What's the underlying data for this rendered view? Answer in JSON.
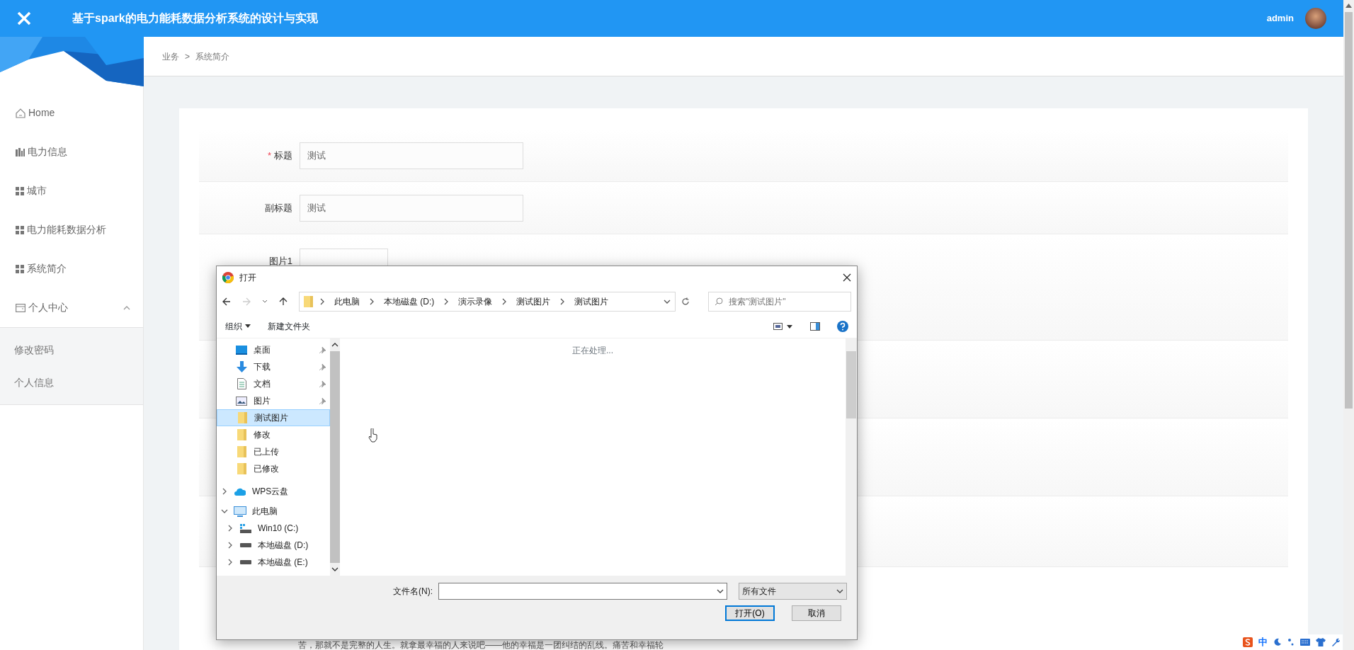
{
  "header": {
    "title": "基于spark的电力能耗数据分析系统的设计与实现",
    "user": "admin"
  },
  "sidebar": {
    "items": [
      {
        "label": "Home",
        "kind": "home"
      },
      {
        "label": "电力信息",
        "kind": "chart"
      },
      {
        "label": "城市",
        "kind": "grid"
      },
      {
        "label": "电力能耗数据分析",
        "kind": "grid"
      },
      {
        "label": "系统简介",
        "kind": "grid"
      },
      {
        "label": "个人中心",
        "kind": "card",
        "expanded": true,
        "children": [
          {
            "label": "修改密码"
          },
          {
            "label": "个人信息"
          }
        ]
      }
    ]
  },
  "breadcrumb": {
    "items": [
      "业务",
      "系统简介"
    ],
    "separator": ">"
  },
  "form": {
    "required_symbol": "*",
    "fields": [
      {
        "label": "标题",
        "required": true,
        "kind": "text",
        "value": "测试"
      },
      {
        "label": "副标题",
        "required": false,
        "kind": "text",
        "value": "测试"
      },
      {
        "label": "图片1",
        "required": false,
        "kind": "upload"
      }
    ],
    "content_excerpt": "苦，那就不是完整的人生。就拿最幸福的人来说吧——他的幸福是一团纠结的乱线。痛苦和幸福轮"
  },
  "dialog": {
    "title": "打开",
    "path": [
      "此电脑",
      "本地磁盘 (D:)",
      "演示录像",
      "测试图片",
      "测试图片"
    ],
    "search_placeholder": "搜索\"测试图片\"",
    "toolbar": [
      "组织",
      "新建文件夹"
    ],
    "nav": [
      {
        "kind": "desktop",
        "label": "桌面",
        "pinned": true,
        "selected": false
      },
      {
        "kind": "download",
        "label": "下载",
        "pinned": true,
        "selected": false
      },
      {
        "kind": "document",
        "label": "文档",
        "pinned": true,
        "selected": false
      },
      {
        "kind": "picture",
        "label": "图片",
        "pinned": true,
        "selected": false
      },
      {
        "kind": "folder",
        "label": "测试图片",
        "pinned": false,
        "selected": true
      },
      {
        "kind": "folder",
        "label": "修改",
        "pinned": false,
        "selected": false
      },
      {
        "kind": "folder",
        "label": "已上传",
        "pinned": false,
        "selected": false
      },
      {
        "kind": "folder",
        "label": "已修改",
        "pinned": false,
        "selected": false
      },
      {
        "kind": "cloud",
        "label": "WPS云盘",
        "expanded": false,
        "selected": false
      },
      {
        "kind": "pc",
        "label": "此电脑",
        "expanded": true,
        "selected": false,
        "children": [
          {
            "kind": "windrive",
            "label": "Win10 (C:)",
            "expanded": false,
            "selected": false
          },
          {
            "kind": "drive",
            "label": "本地磁盘 (D:)",
            "expanded": false,
            "selected": false
          },
          {
            "kind": "drive",
            "label": "本地磁盘 (E:)",
            "expanded": false,
            "selected": false
          }
        ]
      }
    ],
    "status": "正在处理...",
    "filename_label": "文件名(N):",
    "file_type": "所有文件",
    "buttons": [
      {
        "label": "打开(O)",
        "default": true
      },
      {
        "label": "取消",
        "default": false
      }
    ]
  },
  "tray": {
    "ime": "中"
  }
}
